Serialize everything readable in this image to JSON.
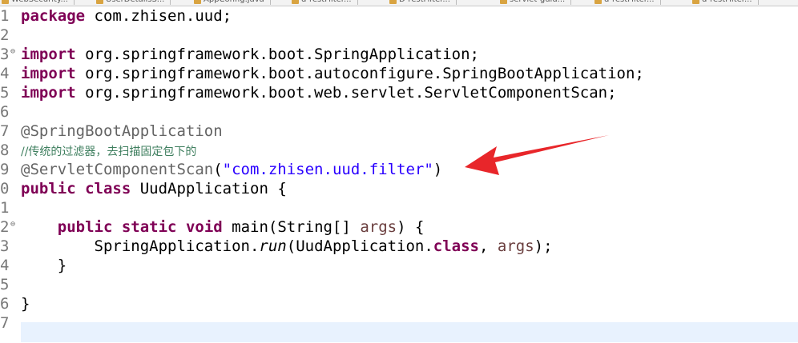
{
  "tabs": [
    "WebSecurity...",
    "UserDetailsS...",
    "AppConfig.java",
    "d-restFilter...",
    "D-restFilter...",
    "servlet-guid...",
    "d-restFilter...",
    "d-restFilter..."
  ],
  "lines": [
    {
      "num": "1",
      "fold": "",
      "tokens": [
        {
          "t": "package",
          "c": "kw"
        },
        {
          "t": " com.zhisen.uud;",
          "c": ""
        }
      ]
    },
    {
      "num": "2",
      "fold": "",
      "tokens": []
    },
    {
      "num": "3",
      "fold": "⊖",
      "tokens": [
        {
          "t": "import",
          "c": "kw"
        },
        {
          "t": " org.springframework.boot.SpringApplication;",
          "c": ""
        }
      ]
    },
    {
      "num": "4",
      "fold": "",
      "tokens": [
        {
          "t": "import",
          "c": "kw"
        },
        {
          "t": " org.springframework.boot.autoconfigure.SpringBootApplication;",
          "c": ""
        }
      ]
    },
    {
      "num": "5",
      "fold": "",
      "tokens": [
        {
          "t": "import",
          "c": "kw"
        },
        {
          "t": " org.springframework.boot.web.servlet.ServletComponentScan;",
          "c": ""
        }
      ]
    },
    {
      "num": "6",
      "fold": "",
      "tokens": []
    },
    {
      "num": "7",
      "fold": "",
      "tokens": [
        {
          "t": "@SpringBootApplication",
          "c": "ann"
        }
      ]
    },
    {
      "num": "8",
      "fold": "",
      "tokens": [
        {
          "t": "//传统的过滤器，去扫描固定包下的",
          "c": "cmt"
        }
      ]
    },
    {
      "num": "9",
      "fold": "",
      "tokens": [
        {
          "t": "@ServletComponentScan",
          "c": "ann"
        },
        {
          "t": "(",
          "c": ""
        },
        {
          "t": "\"com.zhisen.uud.filter\"",
          "c": "str"
        },
        {
          "t": ")",
          "c": ""
        }
      ]
    },
    {
      "num": "0",
      "fold": "",
      "tokens": [
        {
          "t": "public",
          "c": "kw"
        },
        {
          "t": " ",
          "c": ""
        },
        {
          "t": "class",
          "c": "kw"
        },
        {
          "t": " UudApplication {",
          "c": ""
        }
      ]
    },
    {
      "num": "1",
      "fold": "",
      "tokens": []
    },
    {
      "num": "2",
      "fold": "⊖",
      "tokens": [
        {
          "t": "    ",
          "c": ""
        },
        {
          "t": "public",
          "c": "kw"
        },
        {
          "t": " ",
          "c": ""
        },
        {
          "t": "static",
          "c": "kw"
        },
        {
          "t": " ",
          "c": ""
        },
        {
          "t": "void",
          "c": "kw"
        },
        {
          "t": " main(String[] ",
          "c": ""
        },
        {
          "t": "args",
          "c": "var"
        },
        {
          "t": ") {",
          "c": ""
        }
      ]
    },
    {
      "num": "3",
      "fold": "",
      "tokens": [
        {
          "t": "        SpringApplication.",
          "c": ""
        },
        {
          "t": "run",
          "c": "ital"
        },
        {
          "t": "(UudApplication.",
          "c": ""
        },
        {
          "t": "class",
          "c": "kw"
        },
        {
          "t": ", ",
          "c": ""
        },
        {
          "t": "args",
          "c": "var"
        },
        {
          "t": ");",
          "c": ""
        }
      ]
    },
    {
      "num": "4",
      "fold": "",
      "tokens": [
        {
          "t": "    }",
          "c": ""
        }
      ]
    },
    {
      "num": "5",
      "fold": "",
      "tokens": []
    },
    {
      "num": "6",
      "fold": "",
      "tokens": [
        {
          "t": "}",
          "c": ""
        }
      ]
    },
    {
      "num": "7",
      "fold": "",
      "tokens": []
    }
  ],
  "colors": {
    "keyword": "#7f0055",
    "annotation": "#646464",
    "comment": "#3f7f5f",
    "string": "#2a00ff",
    "variable": "#6a3e3e",
    "current_line": "#e8f2fe",
    "arrow": "#e8262a"
  }
}
